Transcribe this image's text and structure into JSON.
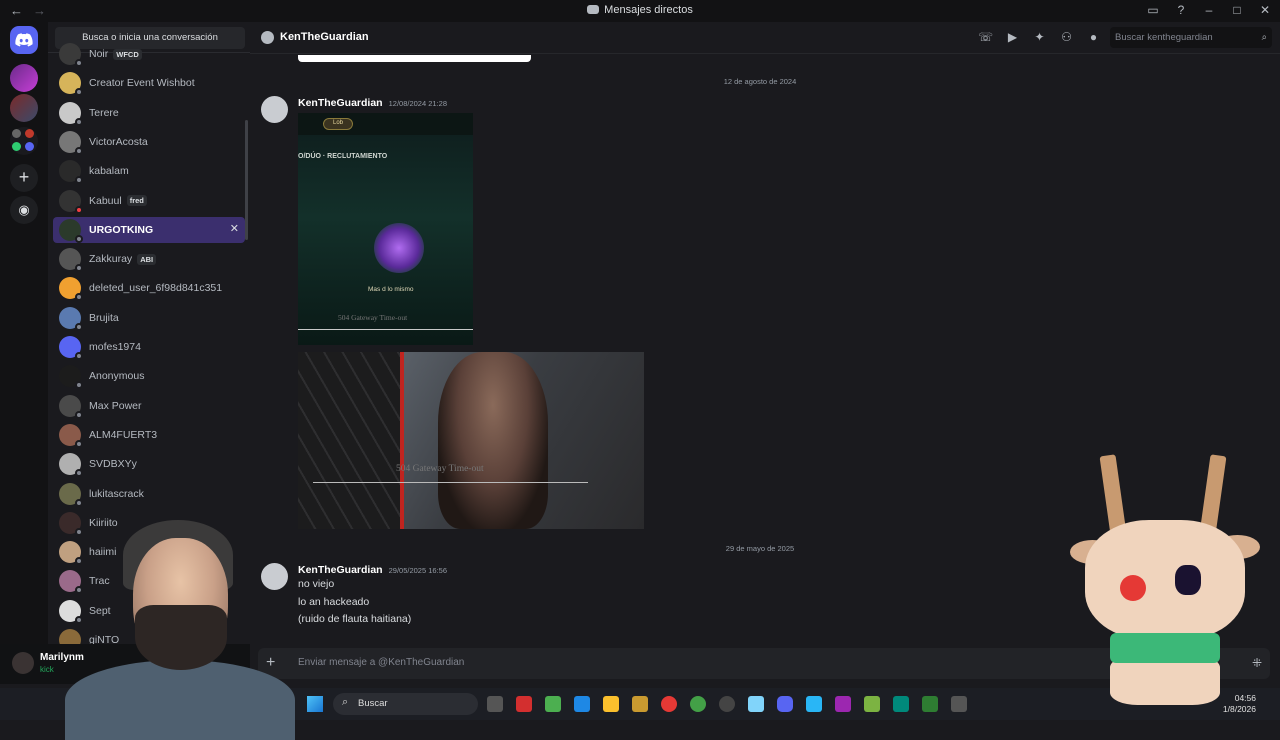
{
  "window": {
    "title": "Mensajes directos"
  },
  "dm_panel": {
    "search_label": "Busca o inicia una conversación",
    "items": [
      {
        "name": "Noir",
        "tag": "WFCD",
        "avatar_color": "#3a3a3a",
        "status_color": "#80848e"
      },
      {
        "name": "Creator Event Wishbot",
        "tag": "",
        "avatar_color": "#d6b45a",
        "status_color": "#80848e"
      },
      {
        "name": "Terere",
        "tag": "",
        "avatar_color": "#c9c9c9",
        "status_color": "#80848e"
      },
      {
        "name": "VictorAcosta",
        "tag": "",
        "avatar_color": "#777777",
        "status_color": "#80848e"
      },
      {
        "name": "kabalam",
        "tag": "",
        "avatar_color": "#2a2a2a",
        "status_color": "#80848e"
      },
      {
        "name": "Kabuul",
        "tag": "fred",
        "avatar_color": "#333333",
        "status_color": "#f23f43"
      },
      {
        "name": "URGOTKING",
        "tag": "",
        "avatar_color": "#2b3a2b",
        "status_color": "#80848e"
      },
      {
        "name": "Zakkuray",
        "tag": "ABI",
        "avatar_color": "#555555",
        "status_color": "#80848e"
      },
      {
        "name": "deleted_user_6f98d841c351",
        "tag": "",
        "avatar_color": "#f0a030",
        "status_color": "#80848e"
      },
      {
        "name": "Brujita",
        "tag": "",
        "avatar_color": "#5a7ab0",
        "status_color": "#80848e"
      },
      {
        "name": "mofes1974",
        "tag": "",
        "avatar_color": "#5865f2",
        "status_color": "#80848e"
      },
      {
        "name": "Anonymous",
        "tag": "",
        "avatar_color": "#1c1c1c",
        "status_color": "#80848e"
      },
      {
        "name": "Max Power",
        "tag": "",
        "avatar_color": "#4a4a4a",
        "status_color": "#80848e"
      },
      {
        "name": "ALM4FUERT3",
        "tag": "",
        "avatar_color": "#8a5a4a",
        "status_color": "#80848e"
      },
      {
        "name": "SVDBXYy",
        "tag": "",
        "avatar_color": "#b0b0b0",
        "status_color": "#80848e"
      },
      {
        "name": "lukitascrack",
        "tag": "",
        "avatar_color": "#6a6a4a",
        "status_color": "#80848e"
      },
      {
        "name": "Kiiriito",
        "tag": "",
        "avatar_color": "#3a2a2a",
        "status_color": "#80848e"
      },
      {
        "name": "haiimi",
        "tag": "",
        "avatar_color": "#c0a080",
        "status_color": "#80848e"
      },
      {
        "name": "Trac",
        "tag": "",
        "avatar_color": "#9a6a8a",
        "status_color": "#80848e"
      },
      {
        "name": "Sept",
        "tag": "",
        "avatar_color": "#dddddd",
        "status_color": "#80848e"
      },
      {
        "name": "giNTO",
        "tag": "",
        "avatar_color": "#8a6a3a",
        "status_color": "#80848e"
      }
    ],
    "active_index": 6
  },
  "user_panel": {
    "name": "Marilynm",
    "status": "kick"
  },
  "chat_header": {
    "name": "KenTheGuardian",
    "search_placeholder": "Buscar kentheguardian",
    "icons": [
      "phone-icon",
      "video-icon",
      "pin-icon",
      "add-friend-icon",
      "profile-icon"
    ]
  },
  "messages": {
    "date_1": "12 de agosto de 2024",
    "group_1": {
      "author": "KenTheGuardian",
      "timestamp": "12/08/2024 21:28",
      "image_1": {
        "header_pill": "Lob",
        "title": "O/DÚO · RECLUTAMIENTO",
        "subtitle": "Mas d lo mismo",
        "error": "504 Gateway Time-out"
      },
      "image_2": {
        "error": "504 Gateway Time-out"
      }
    },
    "date_2": "29 de mayo de 2025",
    "group_2": {
      "author": "KenTheGuardian",
      "timestamp": "29/05/2025 16:56",
      "lines": [
        "no viejo",
        "lo an hackeado",
        "(ruido de flauta haitiana)"
      ]
    }
  },
  "composer": {
    "placeholder": "Enviar mensaje a @KenTheGuardian"
  },
  "taskbar": {
    "search_label": "Buscar",
    "time": "04:56",
    "date": "1/8/2026"
  },
  "colors": {
    "accent": "#5865f2",
    "active_dm": "#3b2f6e",
    "background": "#1a1a1e"
  }
}
